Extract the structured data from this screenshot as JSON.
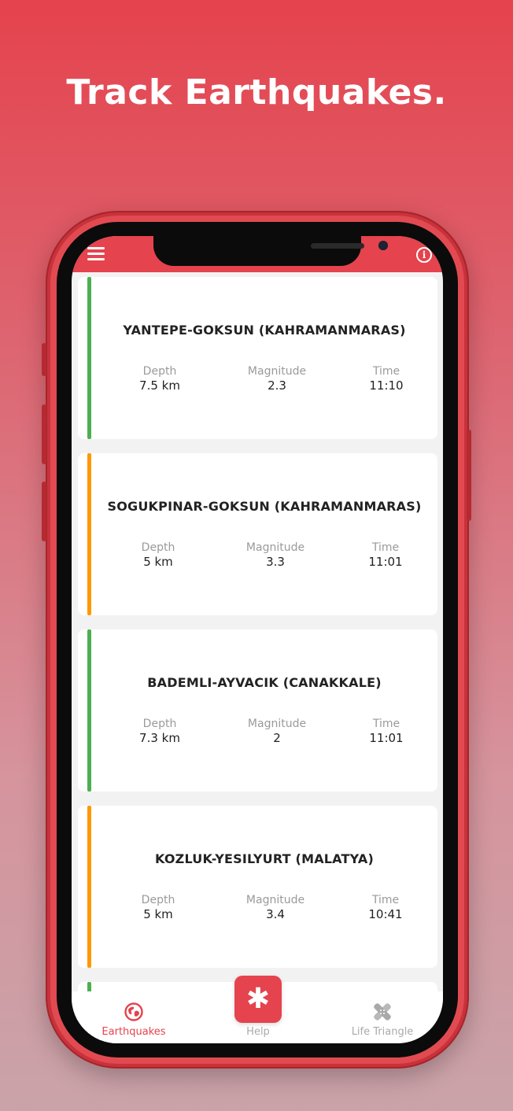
{
  "headline": "Track Earthquakes.",
  "colors": {
    "accent": "#e5434d",
    "green": "#4caf50",
    "orange": "#ff9800"
  },
  "topbar": {
    "menu_icon": "hamburger-menu-icon",
    "info_icon": "info-icon"
  },
  "labels": {
    "depth": "Depth",
    "magnitude": "Magnitude",
    "time": "Time"
  },
  "earthquakes": [
    {
      "location": "YANTEPE-GOKSUN (KAHRAMANMARAS)",
      "depth": "7.5 km",
      "magnitude": "2.3",
      "time": "11:10",
      "level": "green"
    },
    {
      "location": "SOGUKPINAR-GOKSUN (KAHRAMANMARAS)",
      "depth": "5 km",
      "magnitude": "3.3",
      "time": "11:01",
      "level": "orange"
    },
    {
      "location": "BADEMLI-AYVACIK (CANAKKALE)",
      "depth": "7.3 km",
      "magnitude": "2",
      "time": "11:01",
      "level": "green"
    },
    {
      "location": "KOZLUK-YESILYURT (MALATYA)",
      "depth": "5 km",
      "magnitude": "3.4",
      "time": "10:41",
      "level": "orange"
    }
  ],
  "nav": {
    "earthquakes": {
      "label": "Earthquakes",
      "icon": "globe-icon"
    },
    "help": {
      "label": "Help",
      "icon": "asterisk-icon",
      "symbol": "✱"
    },
    "life_triangle": {
      "label": "Life Triangle",
      "icon": "bandage-icon"
    }
  }
}
